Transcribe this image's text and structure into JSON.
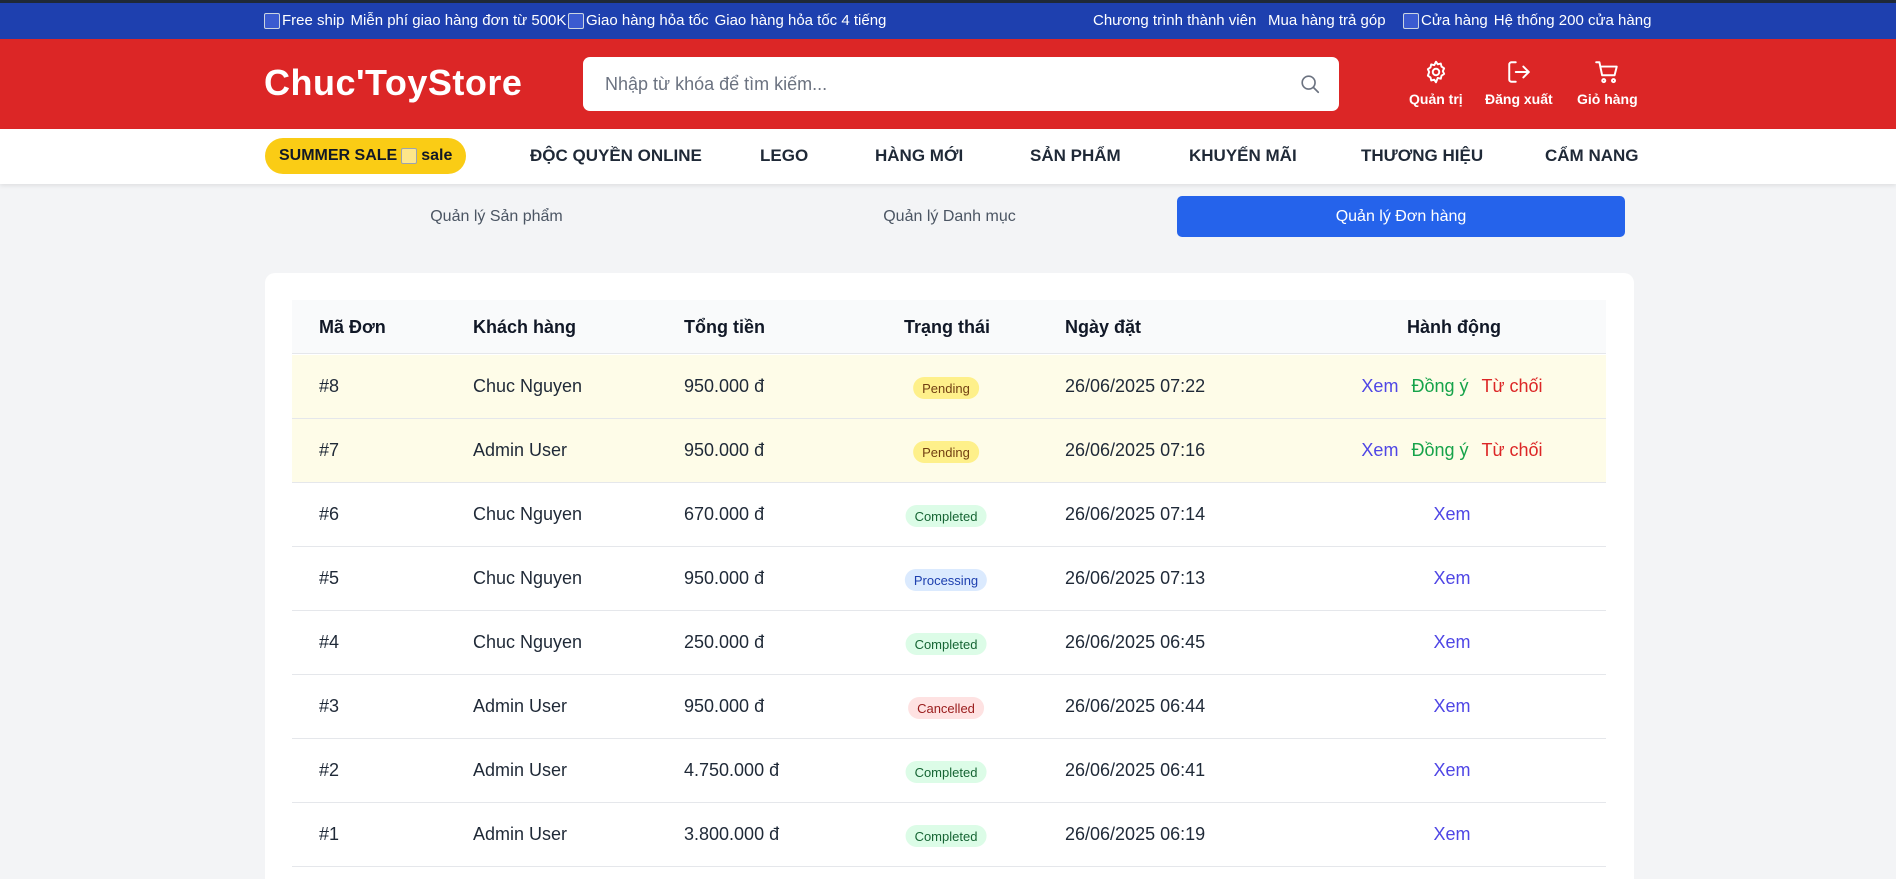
{
  "topbar": {
    "free_ship_alt": "Free ship",
    "free_ship_text": "Miễn phí giao hàng đơn từ 500K",
    "fast_alt": "Giao hàng hỏa tốc",
    "fast_text": "Giao hàng hỏa tốc 4 tiếng",
    "member": "Chương trình thành viên",
    "installment": "Mua hàng trả góp",
    "store_alt": "Cửa hàng",
    "store_text": "Hệ thống 200 cửa hàng"
  },
  "header": {
    "logo": "Chuc'ToyStore",
    "search_placeholder": "Nhập từ khóa để tìm kiếm...",
    "admin_label": "Quản trị",
    "logout_label": "Đăng xuất",
    "cart_label": "Giỏ hàng"
  },
  "nav": {
    "sale_label": "SUMMER SALE",
    "sale_img_alt": "sale",
    "links": [
      "ĐỘC QUYỀN ONLINE",
      "LEGO",
      "HÀNG MỚI",
      "SẢN PHẨM",
      "KHUYẾN MÃI",
      "THƯƠNG HIỆU",
      "CẨM NANG"
    ]
  },
  "tabs": [
    "Quản lý Sản phẩm",
    "Quản lý Danh mục",
    "Quản lý Đơn hàng"
  ],
  "active_tab": "Quản lý Đơn hàng",
  "table": {
    "headers": [
      "Mã Đơn",
      "Khách hàng",
      "Tổng tiền",
      "Trạng thái",
      "Ngày đặt",
      "Hành động"
    ],
    "action_labels": {
      "view": "Xem",
      "approve": "Đồng ý",
      "reject": "Từ chối"
    },
    "rows": [
      {
        "id": "#8",
        "customer": "Chuc Nguyen",
        "total": "950.000 đ",
        "status": "Pending",
        "date": "26/06/2025 07:22"
      },
      {
        "id": "#7",
        "customer": "Admin User",
        "total": "950.000 đ",
        "status": "Pending",
        "date": "26/06/2025 07:16"
      },
      {
        "id": "#6",
        "customer": "Chuc Nguyen",
        "total": "670.000 đ",
        "status": "Completed",
        "date": "26/06/2025 07:14"
      },
      {
        "id": "#5",
        "customer": "Chuc Nguyen",
        "total": "950.000 đ",
        "status": "Processing",
        "date": "26/06/2025 07:13"
      },
      {
        "id": "#4",
        "customer": "Chuc Nguyen",
        "total": "250.000 đ",
        "status": "Completed",
        "date": "26/06/2025 06:45"
      },
      {
        "id": "#3",
        "customer": "Admin User",
        "total": "950.000 đ",
        "status": "Cancelled",
        "date": "26/06/2025 06:44"
      },
      {
        "id": "#2",
        "customer": "Admin User",
        "total": "4.750.000 đ",
        "status": "Completed",
        "date": "26/06/2025 06:41"
      },
      {
        "id": "#1",
        "customer": "Admin User",
        "total": "3.800.000 đ",
        "status": "Completed",
        "date": "26/06/2025 06:19"
      }
    ]
  },
  "colors": {
    "topbar": "#1e40af",
    "header": "#dc2626",
    "sale": "#facc15",
    "active_tab": "#2563eb",
    "pending_row": "#fefce8"
  }
}
